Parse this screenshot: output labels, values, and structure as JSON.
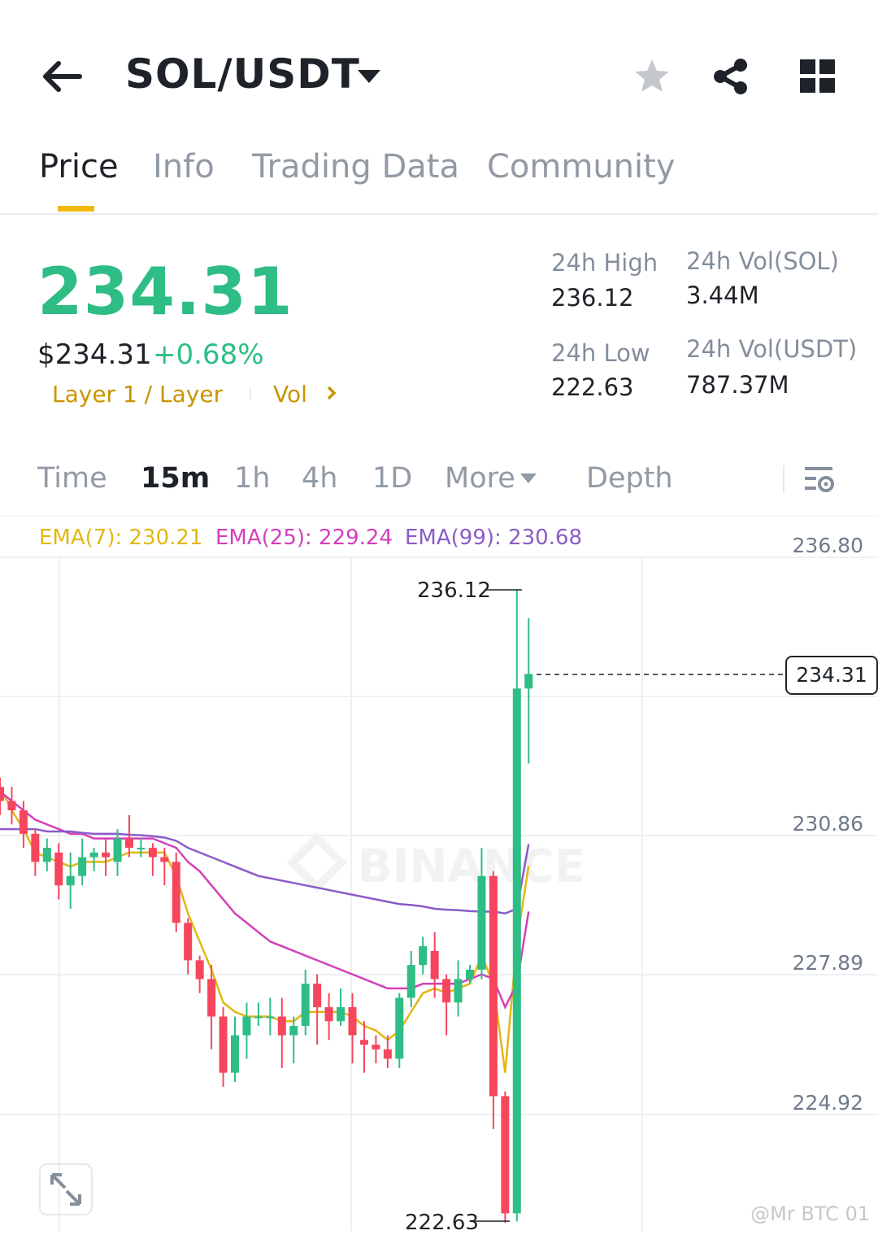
{
  "header": {
    "pair": "SOL/USDT",
    "icons": [
      "back-arrow-icon",
      "dropdown-caret-icon",
      "star-icon",
      "share-icon",
      "grid-icon"
    ]
  },
  "tabs": [
    "Price",
    "Info",
    "Trading Data",
    "Community"
  ],
  "active_tab": "Price",
  "ticker": {
    "last_price": "234.31",
    "usd_price": "$234.31",
    "change_pct": "+0.68%",
    "tag_category": "Layer 1 / Layer",
    "tag_vol": "Vol",
    "high_label": "24h High",
    "high_value": "236.12",
    "low_label": "24h Low",
    "low_value": "222.63",
    "vol_base_label": "24h Vol(SOL)",
    "vol_base_value": "3.44M",
    "vol_quote_label": "24h Vol(USDT)",
    "vol_quote_value": "787.37M"
  },
  "intervals": [
    "Time",
    "15m",
    "1h",
    "4h",
    "1D",
    "More",
    "Depth"
  ],
  "active_interval": "15m",
  "indicators": {
    "ema7": "EMA(7): 230.21",
    "ema25": "EMA(25): 229.24",
    "ema99": "EMA(99): 230.68"
  },
  "chart_data": {
    "type": "candlestick",
    "y_ticks": [
      "236.80",
      "230.86",
      "227.89",
      "224.92"
    ],
    "high_marker": "236.12",
    "low_marker": "222.63",
    "current_price": "234.31",
    "ylim": [
      222.4,
      237.6
    ],
    "candles": [
      [
        231.9,
        231.6,
        232.1,
        231.3
      ],
      [
        231.6,
        231.4,
        231.9,
        231.1
      ],
      [
        231.4,
        230.9,
        231.6,
        230.6
      ],
      [
        230.9,
        230.3,
        231.0,
        230.0
      ],
      [
        230.3,
        230.6,
        230.8,
        230.1
      ],
      [
        230.5,
        229.8,
        230.7,
        229.5
      ],
      [
        229.8,
        230.0,
        230.5,
        229.3
      ],
      [
        230.0,
        230.4,
        230.8,
        229.8
      ],
      [
        230.4,
        230.5,
        230.6,
        230.1
      ],
      [
        230.5,
        230.4,
        230.8,
        230.0
      ],
      [
        230.3,
        230.8,
        231.0,
        230.0
      ],
      [
        230.8,
        230.6,
        231.3,
        230.4
      ],
      [
        230.6,
        230.6,
        230.8,
        230.4
      ],
      [
        230.6,
        230.4,
        230.7,
        230.0
      ],
      [
        230.4,
        230.3,
        230.6,
        229.8
      ],
      [
        230.3,
        229.0,
        230.5,
        228.8
      ],
      [
        229.0,
        228.2,
        229.1,
        227.9
      ],
      [
        228.2,
        227.8,
        228.3,
        227.5
      ],
      [
        227.8,
        227.0,
        228.1,
        226.3
      ],
      [
        227.0,
        225.8,
        227.2,
        225.5
      ],
      [
        225.8,
        226.6,
        227.0,
        225.6
      ],
      [
        226.6,
        227.0,
        227.3,
        226.1
      ],
      [
        227.0,
        227.0,
        227.3,
        226.8
      ],
      [
        227.0,
        227.0,
        227.4,
        226.6
      ],
      [
        227.0,
        226.6,
        227.4,
        225.9
      ],
      [
        226.6,
        226.8,
        227.0,
        226.0
      ],
      [
        226.8,
        227.7,
        228.0,
        226.6
      ],
      [
        227.7,
        227.2,
        227.9,
        226.4
      ],
      [
        227.2,
        226.9,
        227.5,
        226.5
      ],
      [
        226.9,
        227.2,
        227.6,
        226.8
      ],
      [
        227.2,
        226.6,
        227.5,
        226.0
      ],
      [
        226.5,
        226.4,
        226.9,
        225.8
      ],
      [
        226.4,
        226.3,
        226.6,
        226.0
      ],
      [
        226.3,
        226.1,
        226.6,
        225.9
      ],
      [
        226.1,
        227.4,
        227.5,
        225.9
      ],
      [
        227.4,
        228.1,
        228.4,
        227.2
      ],
      [
        228.1,
        228.5,
        228.7,
        227.9
      ],
      [
        228.4,
        227.8,
        228.8,
        227.4
      ],
      [
        227.8,
        227.3,
        227.9,
        226.6
      ],
      [
        227.3,
        227.8,
        228.2,
        227.0
      ],
      [
        227.8,
        228.0,
        228.1,
        227.7
      ],
      [
        228.0,
        230.0,
        230.6,
        227.8
      ],
      [
        230.0,
        225.3,
        230.1,
        224.6
      ],
      [
        225.3,
        222.8,
        225.4,
        222.6
      ],
      [
        222.8,
        234.0,
        236.12,
        222.63
      ],
      [
        234.0,
        234.31,
        235.5,
        232.4
      ]
    ],
    "ema_lines": [
      {
        "name": "EMA(7)",
        "values": [
          231.9,
          231.4,
          231.0,
          230.5,
          230.4,
          230.3,
          230.2,
          230.3,
          230.3,
          230.3,
          230.4,
          230.5,
          230.5,
          230.5,
          230.5,
          230.0,
          229.2,
          228.6,
          228.0,
          227.3,
          227.1,
          227.0,
          227.0,
          227.0,
          226.9,
          226.9,
          227.1,
          227.1,
          227.1,
          227.1,
          227.0,
          226.8,
          226.7,
          226.5,
          226.7,
          227.1,
          227.5,
          227.6,
          227.5,
          227.6,
          227.7,
          228.3,
          227.7,
          225.8,
          228.6,
          230.21
        ]
      },
      {
        "name": "EMA(25)",
        "values": [
          231.8,
          231.6,
          231.4,
          231.2,
          231.1,
          231.0,
          230.9,
          230.9,
          230.8,
          230.8,
          230.8,
          230.8,
          230.8,
          230.8,
          230.7,
          230.6,
          230.3,
          230.1,
          229.8,
          229.5,
          229.2,
          229.0,
          228.8,
          228.6,
          228.5,
          228.4,
          228.3,
          228.2,
          228.1,
          228.0,
          227.9,
          227.8,
          227.7,
          227.6,
          227.6,
          227.6,
          227.7,
          227.7,
          227.7,
          227.7,
          227.8,
          227.9,
          227.8,
          227.2,
          227.7,
          229.24
        ]
      },
      {
        "name": "EMA(99)",
        "values": [
          231.0,
          231.0,
          231.0,
          231.0,
          230.95,
          230.95,
          230.95,
          230.92,
          230.9,
          230.9,
          230.9,
          230.88,
          230.87,
          230.85,
          230.82,
          230.75,
          230.6,
          230.5,
          230.4,
          230.3,
          230.2,
          230.1,
          230.0,
          229.95,
          229.9,
          229.85,
          229.8,
          229.75,
          229.7,
          229.65,
          229.6,
          229.55,
          229.5,
          229.45,
          229.4,
          229.38,
          229.35,
          229.3,
          229.28,
          229.27,
          229.25,
          229.24,
          229.24,
          229.2,
          229.3,
          230.68
        ]
      }
    ]
  },
  "colors": {
    "up": "#2ebd85",
    "down": "#f6465d",
    "accent": "#f0b90b",
    "ema7": "#e2b714",
    "ema25": "#d43fba",
    "ema99": "#8a5cc6"
  },
  "watermark": {
    "center": "BINANCE",
    "author": "@Mr BTC 01"
  }
}
